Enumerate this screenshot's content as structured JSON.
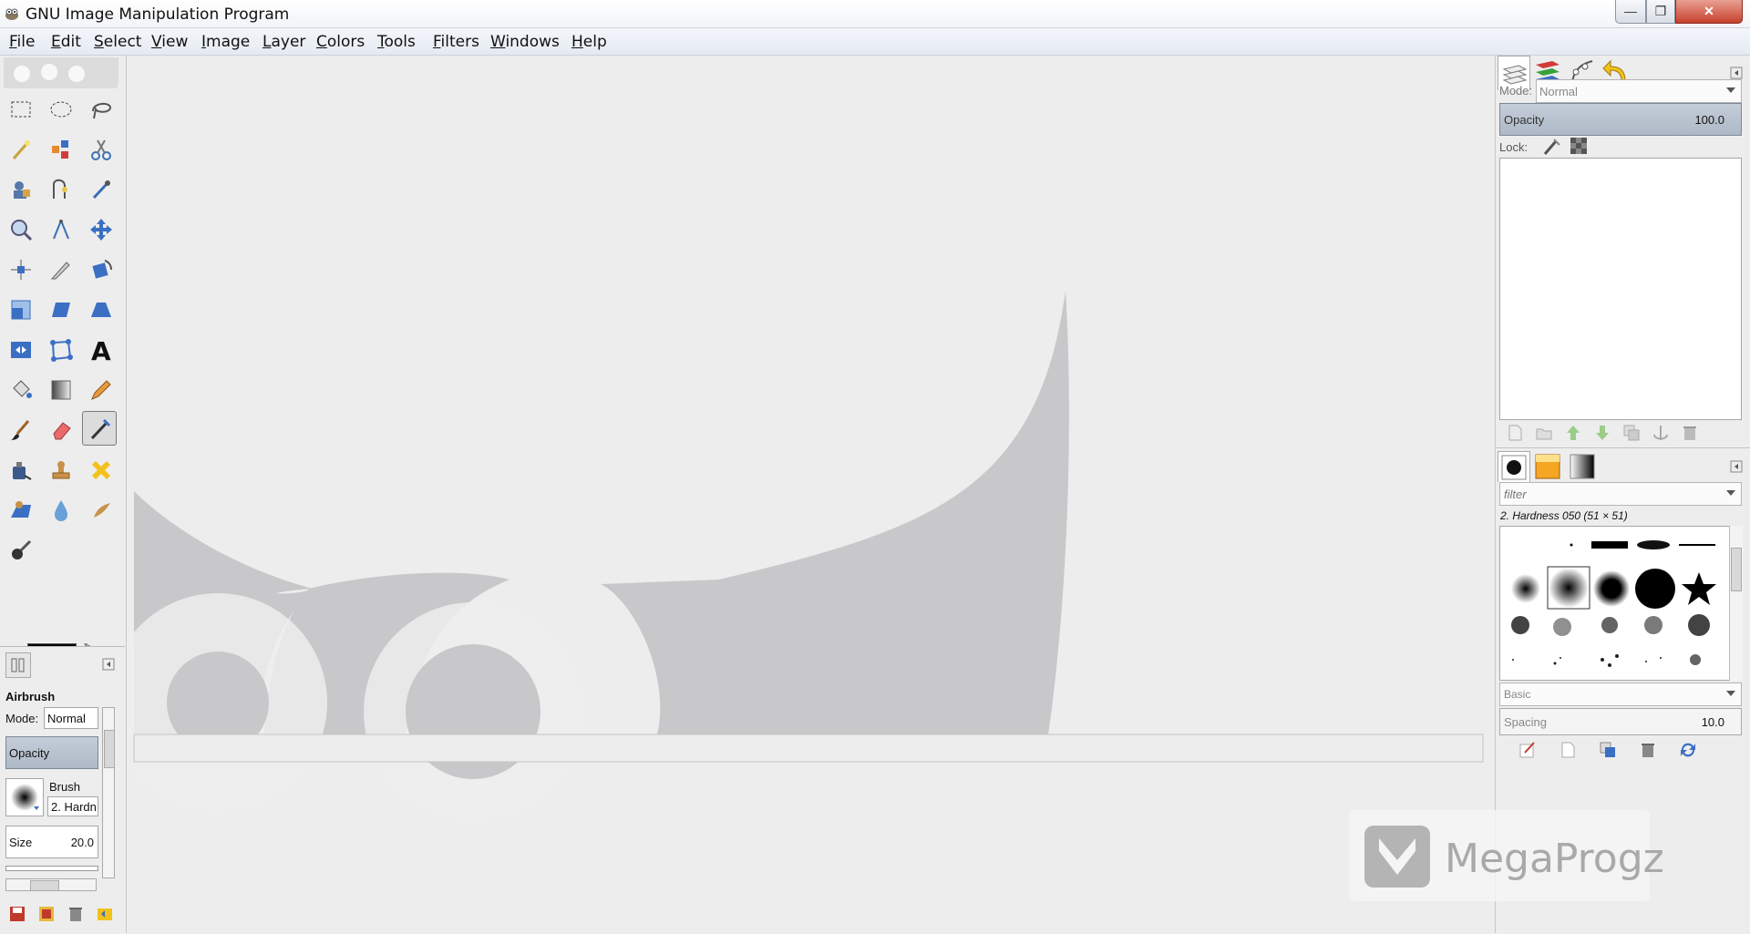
{
  "window": {
    "title": "GNU Image Manipulation Program",
    "buttons": {
      "minimize": "—",
      "maximize": "❐",
      "close": "✕"
    }
  },
  "menubar": {
    "items": [
      "File",
      "Edit",
      "Select",
      "View",
      "Image",
      "Layer",
      "Colors",
      "Tools",
      "Filters",
      "Windows",
      "Help"
    ]
  },
  "toolbox": {
    "tools": [
      "rect-select",
      "ellipse-select",
      "free-select",
      "fuzzy-select",
      "color-select",
      "scissors-select",
      "foreground-select",
      "paths",
      "color-picker",
      "zoom",
      "measure",
      "move",
      "align",
      "crop",
      "rotate",
      "scale",
      "shear",
      "perspective",
      "flip",
      "cage-transform",
      "text",
      "bucket-fill",
      "blend",
      "pencil",
      "paintbrush",
      "eraser",
      "airbrush",
      "ink",
      "clone",
      "heal",
      "perspective-clone",
      "blur-sharpen",
      "smudge",
      "dodge-burn"
    ],
    "active_tool": "airbrush",
    "colors": {
      "foreground": "#000000",
      "background": "#ffffff"
    }
  },
  "tool_options": {
    "title": "Airbrush",
    "mode_label": "Mode:",
    "mode_value": "Normal",
    "opacity_label": "Opacity",
    "brush_label": "Brush",
    "brush_value": "2. Hardn",
    "size_label": "Size",
    "size_value": "20.0"
  },
  "layers_panel": {
    "mode_label": "Mode:",
    "mode_value": "Normal",
    "opacity_label": "Opacity",
    "opacity_value": "100.0",
    "lock_label": "Lock:"
  },
  "brushes_panel": {
    "filter_placeholder": "filter",
    "selected_brush": "2. Hardness 050 (51 × 51)",
    "preset_value": "Basic",
    "spacing_label": "Spacing",
    "spacing_value": "10.0"
  },
  "watermark": {
    "text": "MegaProgz"
  }
}
